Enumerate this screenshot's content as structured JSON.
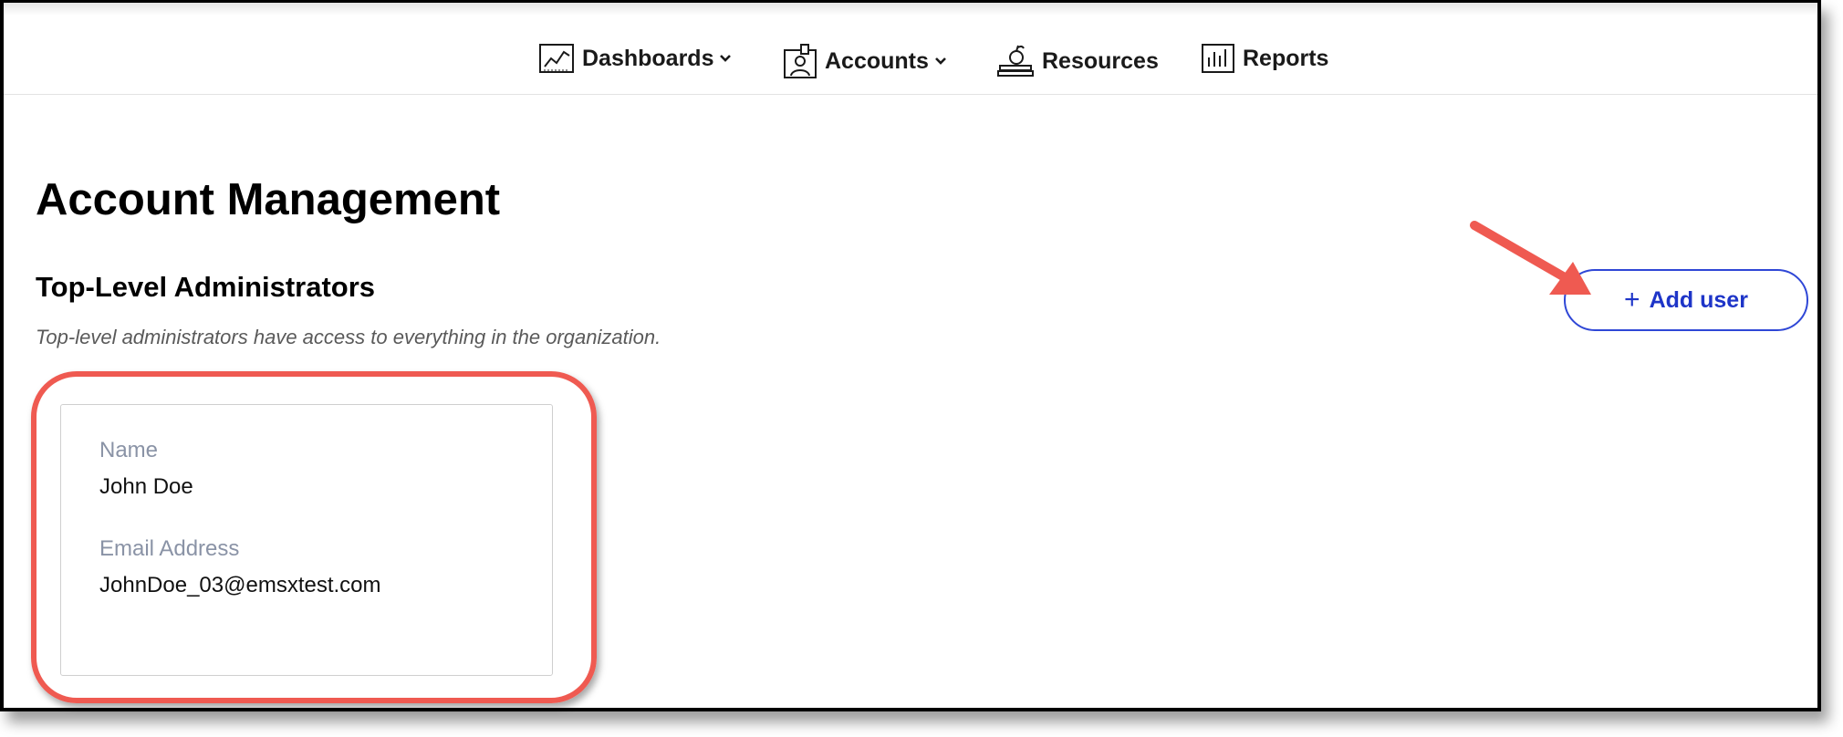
{
  "nav": {
    "dashboards_label": "Dashboards",
    "accounts_label": "Accounts",
    "resources_label": "Resources",
    "reports_label": "Reports"
  },
  "page": {
    "title": "Account Management",
    "section_title": "Top-Level Administrators",
    "section_description": "Top-level administrators have access to everything in the organization.",
    "add_user_label": "Add user"
  },
  "admin_card": {
    "name_label": "Name",
    "name_value": "John Doe",
    "email_label": "Email Address",
    "email_value": "JohnDoe_03@emsxtest.com"
  },
  "colors": {
    "accent": "#1e35c8",
    "annotation": "#ef5a51",
    "muted_label": "#8a93a6"
  },
  "icons": [
    "dashboard-chart-icon",
    "accounts-icon",
    "resources-icon",
    "reports-icon",
    "chevron-down-icon",
    "plus-icon",
    "annotation-arrow"
  ]
}
